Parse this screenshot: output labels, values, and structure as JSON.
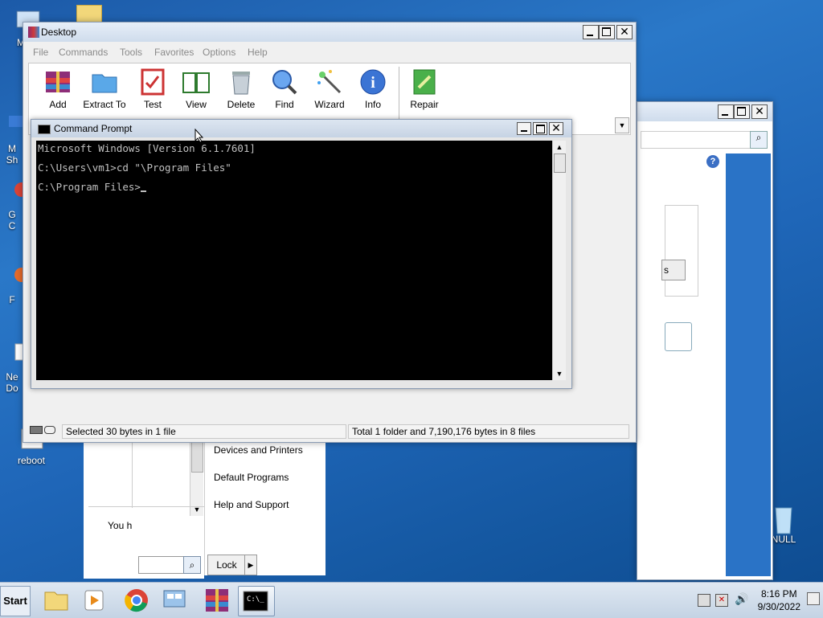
{
  "desktop_icons": [
    {
      "label": "My C",
      "icon": "computer-icon"
    },
    {
      "label": "M\nSh",
      "icon": "folder-icon"
    },
    {
      "label": "G\nC",
      "icon": "chrome-icon"
    },
    {
      "label": "F",
      "icon": "firefox-icon"
    },
    {
      "label": "Ne\nDo",
      "icon": "document-icon"
    },
    {
      "label": "reboot",
      "icon": "reboot-icon"
    },
    {
      "label": "NULL",
      "icon": "recycle-bin-icon"
    }
  ],
  "winrar": {
    "title": "Desktop",
    "menu": [
      "File",
      "Commands",
      "Tools",
      "Favorites",
      "Options",
      "Help"
    ],
    "tools": [
      "Add",
      "Extract To",
      "Test",
      "View",
      "Delete",
      "Find",
      "Wizard",
      "Info",
      "Repair"
    ],
    "status_left": "Selected 30 bytes in 1 file",
    "status_right": "Total 1 folder and 7,190,176 bytes in 8 files"
  },
  "cmd": {
    "title": "Command Prompt",
    "lines": [
      "Microsoft Windows [Version 6.1.7601]",
      "",
      "C:\\Users\\vm1>cd \"\\Program Files\"",
      "",
      "C:\\Program Files>"
    ]
  },
  "start_menu": {
    "items": [
      "Devices and Printers",
      "Default Programs",
      "Help and Support"
    ],
    "lock_label": "Lock",
    "partial_text": "You h",
    "partial_btn": "s"
  },
  "taskbar": {
    "start_label": "Start",
    "time": "8:16 PM",
    "date": "9/30/2022"
  }
}
